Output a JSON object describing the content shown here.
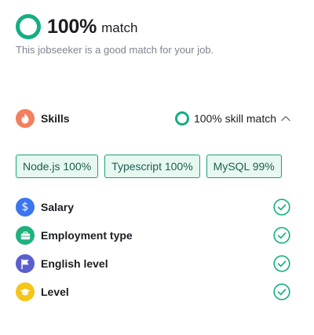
{
  "header": {
    "match_percent": "100%",
    "match_suffix": "match",
    "subtitle": "This jobseeker is a good match for your job."
  },
  "skills": {
    "label": "Skills",
    "icon": "flame-icon",
    "match_text": "100% skill match",
    "expanded": true,
    "tags": [
      {
        "label": "Node.js 100%"
      },
      {
        "label": "Typescript 100%"
      },
      {
        "label": "MySQL 99%"
      }
    ]
  },
  "criteria": [
    {
      "label": "Salary",
      "icon": "dollar-icon",
      "color": "#3b76f0",
      "matched": true
    },
    {
      "label": "Employment type",
      "icon": "briefcase-icon",
      "color": "#1fb17d",
      "matched": true
    },
    {
      "label": "English level",
      "icon": "flag-icon",
      "color": "#5a5fcf",
      "matched": true
    },
    {
      "label": "Level",
      "icon": "graduation-cap-icon",
      "color": "#f5c518",
      "matched": true
    }
  ],
  "colors": {
    "accent": "#14ae82",
    "skills_icon_bg": "#f57e5c",
    "tag_border": "#1aa07a",
    "tag_bg": "#e7f8f1"
  }
}
